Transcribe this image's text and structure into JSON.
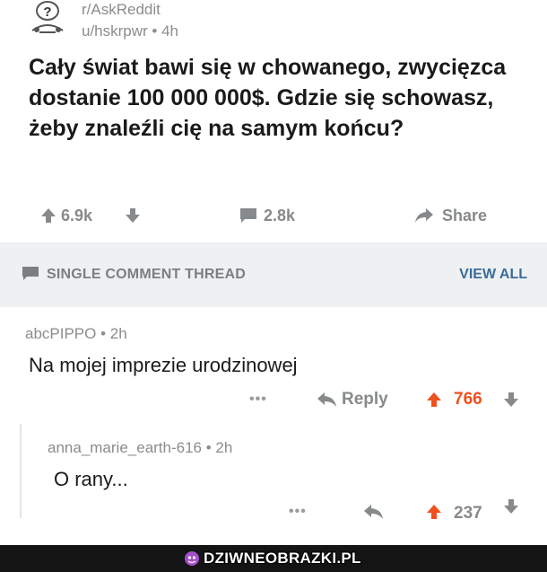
{
  "post": {
    "subreddit": "r/AskReddit",
    "user_line": "u/hskrpwr • 4h",
    "title": "Cały świat bawi się w chowanego, zwycięzca dostanie 100 000 000$. Gdzie się schowasz, żeby znaleźli cię na samym końcu?",
    "upvotes": "6.9k",
    "comments": "2.8k",
    "share_label": "Share"
  },
  "section": {
    "label": "SINGLE COMMENT THREAD",
    "view_all": "VIEW ALL"
  },
  "comments": [
    {
      "meta": "abcPIPPO • 2h",
      "body": "Na mojej imprezie urodzinowej",
      "more": "•••",
      "reply_label": "Reply",
      "score": "766"
    },
    {
      "meta": "anna_marie_earth-616 • 2h",
      "body": "O rany...",
      "more": "•••",
      "score": "237"
    }
  ],
  "watermark": {
    "text": "DZIWNEOBRAZKI.PL"
  },
  "colors": {
    "upvote_active": "#f0501e",
    "muted": "#878a8c",
    "link": "#3a6d99"
  },
  "icons": [
    "reddit-snoo-icon",
    "upvote-icon",
    "downvote-icon",
    "comment-icon",
    "share-icon",
    "reply-icon",
    "more-icon"
  ]
}
